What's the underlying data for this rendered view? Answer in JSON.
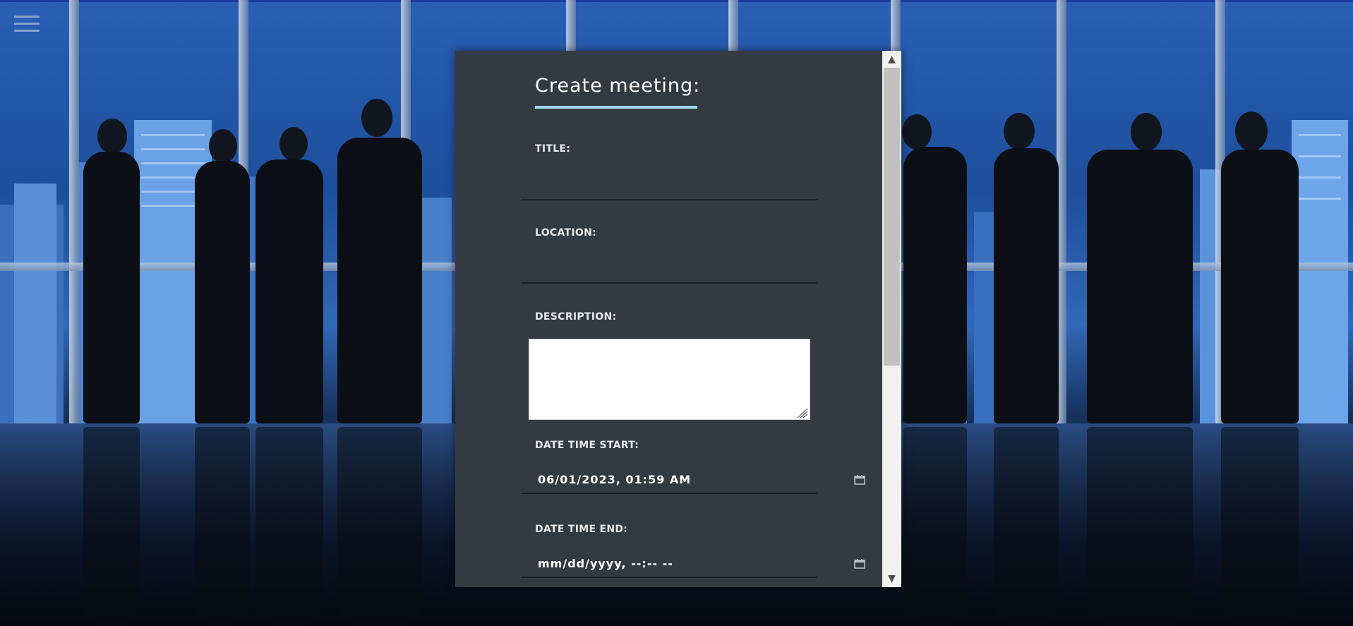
{
  "background": {
    "description_icon": "office-skyline-photo"
  },
  "menu": {
    "icon": "hamburger-menu-icon"
  },
  "modal": {
    "title": "Create meeting:",
    "accent_color": "#9fd8e8",
    "background_color": "#343a42",
    "fields": {
      "title_label": "TITLE:",
      "title_value": "",
      "location_label": "LOCATION:",
      "location_value": "",
      "description_label": "DESCRIPTION:",
      "description_value": "",
      "start_label": "DATE TIME START:",
      "start_value": "06/01/2023, 01:59  AM",
      "end_label": "DATE TIME END:",
      "end_value": "mm/dd/yyyy, --:--  --"
    },
    "calendar_icon": "calendar-icon"
  },
  "scrollbar": {
    "up_arrow": "▲",
    "down_arrow": "▼"
  }
}
